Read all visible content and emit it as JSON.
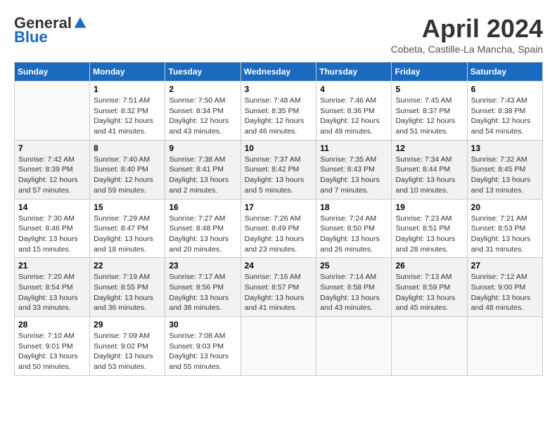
{
  "header": {
    "logo_general": "General",
    "logo_blue": "Blue",
    "month_title": "April 2024",
    "location": "Cobeta, Castille-La Mancha, Spain"
  },
  "days_of_week": [
    "Sunday",
    "Monday",
    "Tuesday",
    "Wednesday",
    "Thursday",
    "Friday",
    "Saturday"
  ],
  "weeks": [
    [
      {
        "day": "",
        "info": ""
      },
      {
        "day": "1",
        "info": "Sunrise: 7:51 AM\nSunset: 8:32 PM\nDaylight: 12 hours\nand 41 minutes."
      },
      {
        "day": "2",
        "info": "Sunrise: 7:50 AM\nSunset: 8:34 PM\nDaylight: 12 hours\nand 43 minutes."
      },
      {
        "day": "3",
        "info": "Sunrise: 7:48 AM\nSunset: 8:35 PM\nDaylight: 12 hours\nand 46 minutes."
      },
      {
        "day": "4",
        "info": "Sunrise: 7:46 AM\nSunset: 8:36 PM\nDaylight: 12 hours\nand 49 minutes."
      },
      {
        "day": "5",
        "info": "Sunrise: 7:45 AM\nSunset: 8:37 PM\nDaylight: 12 hours\nand 51 minutes."
      },
      {
        "day": "6",
        "info": "Sunrise: 7:43 AM\nSunset: 8:38 PM\nDaylight: 12 hours\nand 54 minutes."
      }
    ],
    [
      {
        "day": "7",
        "info": "Sunrise: 7:42 AM\nSunset: 8:39 PM\nDaylight: 12 hours\nand 57 minutes."
      },
      {
        "day": "8",
        "info": "Sunrise: 7:40 AM\nSunset: 8:40 PM\nDaylight: 12 hours\nand 59 minutes."
      },
      {
        "day": "9",
        "info": "Sunrise: 7:38 AM\nSunset: 8:41 PM\nDaylight: 13 hours\nand 2 minutes."
      },
      {
        "day": "10",
        "info": "Sunrise: 7:37 AM\nSunset: 8:42 PM\nDaylight: 13 hours\nand 5 minutes."
      },
      {
        "day": "11",
        "info": "Sunrise: 7:35 AM\nSunset: 8:43 PM\nDaylight: 13 hours\nand 7 minutes."
      },
      {
        "day": "12",
        "info": "Sunrise: 7:34 AM\nSunset: 8:44 PM\nDaylight: 13 hours\nand 10 minutes."
      },
      {
        "day": "13",
        "info": "Sunrise: 7:32 AM\nSunset: 8:45 PM\nDaylight: 13 hours\nand 13 minutes."
      }
    ],
    [
      {
        "day": "14",
        "info": "Sunrise: 7:30 AM\nSunset: 8:46 PM\nDaylight: 13 hours\nand 15 minutes."
      },
      {
        "day": "15",
        "info": "Sunrise: 7:29 AM\nSunset: 8:47 PM\nDaylight: 13 hours\nand 18 minutes."
      },
      {
        "day": "16",
        "info": "Sunrise: 7:27 AM\nSunset: 8:48 PM\nDaylight: 13 hours\nand 20 minutes."
      },
      {
        "day": "17",
        "info": "Sunrise: 7:26 AM\nSunset: 8:49 PM\nDaylight: 13 hours\nand 23 minutes."
      },
      {
        "day": "18",
        "info": "Sunrise: 7:24 AM\nSunset: 8:50 PM\nDaylight: 13 hours\nand 26 minutes."
      },
      {
        "day": "19",
        "info": "Sunrise: 7:23 AM\nSunset: 8:51 PM\nDaylight: 13 hours\nand 28 minutes."
      },
      {
        "day": "20",
        "info": "Sunrise: 7:21 AM\nSunset: 8:53 PM\nDaylight: 13 hours\nand 31 minutes."
      }
    ],
    [
      {
        "day": "21",
        "info": "Sunrise: 7:20 AM\nSunset: 8:54 PM\nDaylight: 13 hours\nand 33 minutes."
      },
      {
        "day": "22",
        "info": "Sunrise: 7:19 AM\nSunset: 8:55 PM\nDaylight: 13 hours\nand 36 minutes."
      },
      {
        "day": "23",
        "info": "Sunrise: 7:17 AM\nSunset: 8:56 PM\nDaylight: 13 hours\nand 38 minutes."
      },
      {
        "day": "24",
        "info": "Sunrise: 7:16 AM\nSunset: 8:57 PM\nDaylight: 13 hours\nand 41 minutes."
      },
      {
        "day": "25",
        "info": "Sunrise: 7:14 AM\nSunset: 8:58 PM\nDaylight: 13 hours\nand 43 minutes."
      },
      {
        "day": "26",
        "info": "Sunrise: 7:13 AM\nSunset: 8:59 PM\nDaylight: 13 hours\nand 45 minutes."
      },
      {
        "day": "27",
        "info": "Sunrise: 7:12 AM\nSunset: 9:00 PM\nDaylight: 13 hours\nand 48 minutes."
      }
    ],
    [
      {
        "day": "28",
        "info": "Sunrise: 7:10 AM\nSunset: 9:01 PM\nDaylight: 13 hours\nand 50 minutes."
      },
      {
        "day": "29",
        "info": "Sunrise: 7:09 AM\nSunset: 9:02 PM\nDaylight: 13 hours\nand 53 minutes."
      },
      {
        "day": "30",
        "info": "Sunrise: 7:08 AM\nSunset: 9:03 PM\nDaylight: 13 hours\nand 55 minutes."
      },
      {
        "day": "",
        "info": ""
      },
      {
        "day": "",
        "info": ""
      },
      {
        "day": "",
        "info": ""
      },
      {
        "day": "",
        "info": ""
      }
    ]
  ]
}
